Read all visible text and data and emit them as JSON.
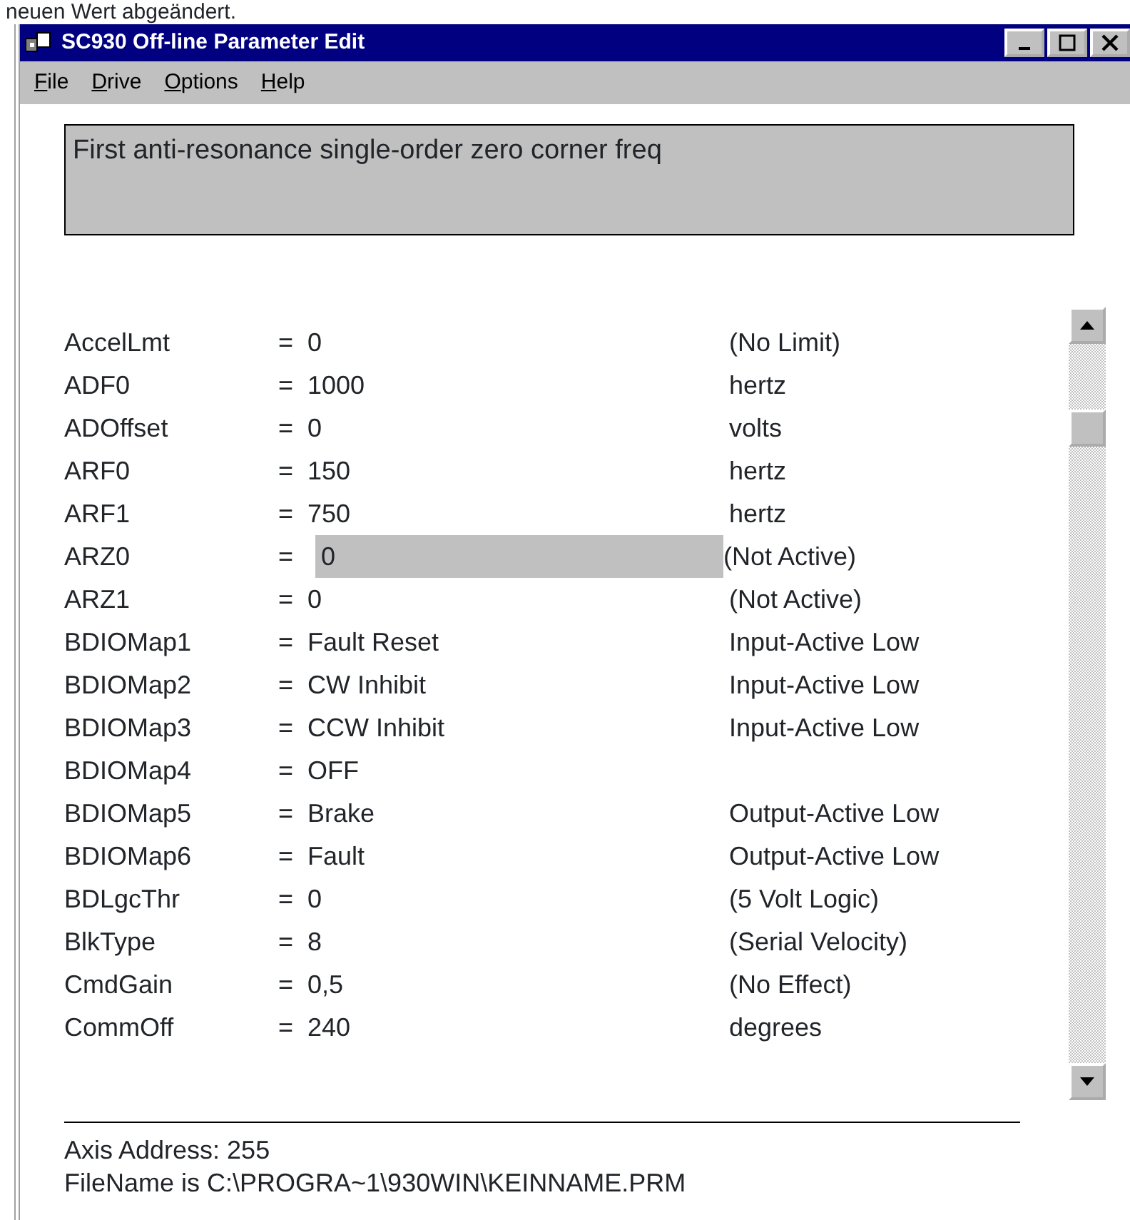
{
  "document_text": "neuen Wert abgeändert.",
  "window": {
    "title": "SC930 Off-line Parameter Edit"
  },
  "menu": [
    {
      "label": "File"
    },
    {
      "label": "Drive"
    },
    {
      "label": "Options"
    },
    {
      "label": "Help"
    }
  ],
  "description": "First anti-resonance single-order zero corner freq",
  "parameters": [
    {
      "name": "AccelLmt",
      "eq": "=",
      "value": "0",
      "unit": "(No Limit)",
      "selected": false
    },
    {
      "name": "ADF0",
      "eq": "=",
      "value": "1000",
      "unit": "hertz",
      "selected": false
    },
    {
      "name": "ADOffset",
      "eq": "=",
      "value": "0",
      "unit": "volts",
      "selected": false
    },
    {
      "name": "ARF0",
      "eq": "=",
      "value": "150",
      "unit": "hertz",
      "selected": false
    },
    {
      "name": "ARF1",
      "eq": "=",
      "value": "750",
      "unit": "hertz",
      "selected": false
    },
    {
      "name": "ARZ0",
      "eq": "=",
      "value": "0",
      "unit": "(Not Active)",
      "selected": true
    },
    {
      "name": "ARZ1",
      "eq": "=",
      "value": "0",
      "unit": "(Not Active)",
      "selected": false
    },
    {
      "name": "BDIOMap1",
      "eq": "=",
      "value": "Fault Reset",
      "unit": "Input-Active Low",
      "selected": false
    },
    {
      "name": "BDIOMap2",
      "eq": "=",
      "value": "CW Inhibit",
      "unit": "Input-Active Low",
      "selected": false
    },
    {
      "name": "BDIOMap3",
      "eq": "=",
      "value": "CCW Inhibit",
      "unit": "Input-Active Low",
      "selected": false
    },
    {
      "name": "BDIOMap4",
      "eq": "=",
      "value": "OFF",
      "selected": false
    },
    {
      "name": "BDIOMap5",
      "eq": "=",
      "value": "Brake",
      "unit": "Output-Active Low",
      "selected": false
    },
    {
      "name": "BDIOMap6",
      "eq": "=",
      "value": "Fault",
      "unit": "Output-Active Low",
      "selected": false
    },
    {
      "name": "BDLgcThr",
      "eq": "=",
      "value": "0",
      "unit": "(5 Volt Logic)",
      "selected": false
    },
    {
      "name": "BlkType",
      "eq": "=",
      "value": "8",
      "unit": "(Serial Velocity)",
      "selected": false
    },
    {
      "name": "CmdGain",
      "eq": "=",
      "value": "0,5",
      "unit": "(No Effect)",
      "selected": false
    },
    {
      "name": "CommOff",
      "eq": "=",
      "value": "240",
      "unit": "degrees",
      "selected": false
    }
  ],
  "status": [
    "Axis Address: 255",
    "FileName is C:\\PROGRA~1\\930WIN\\KEINNAME.PRM"
  ]
}
